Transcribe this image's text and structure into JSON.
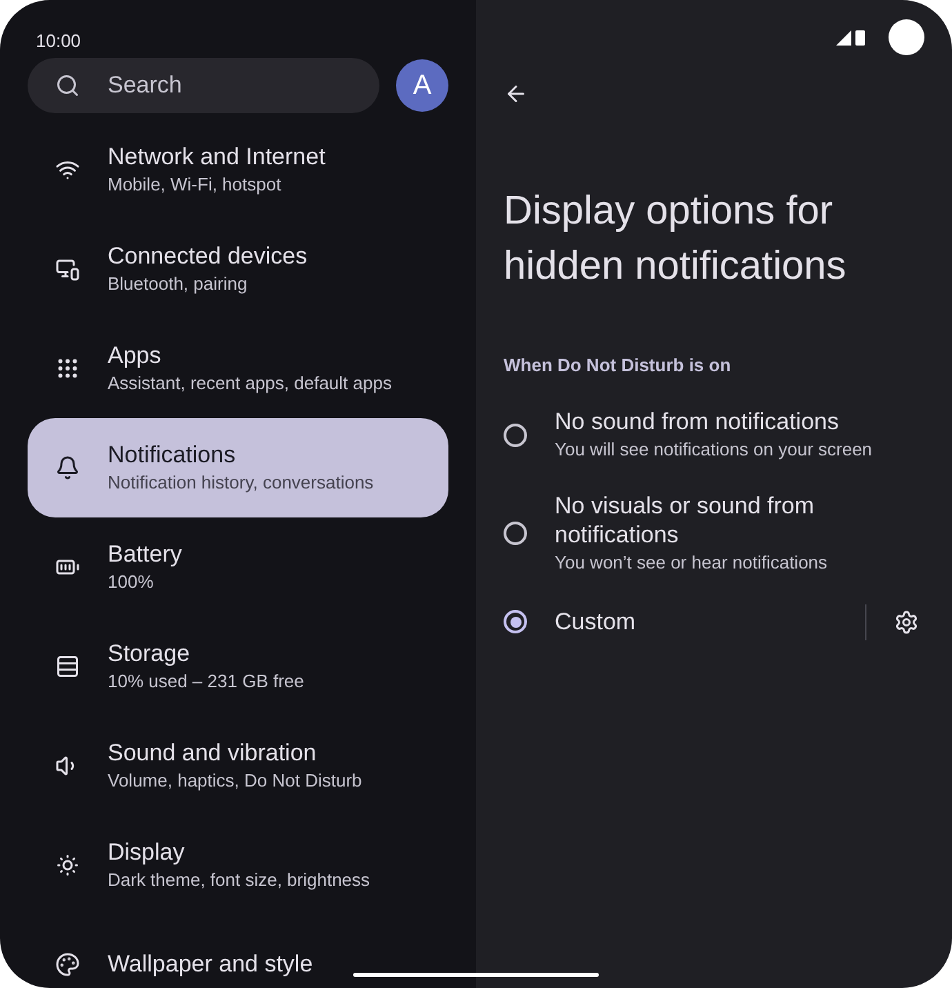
{
  "status_bar": {
    "time": "10:00"
  },
  "search": {
    "placeholder": "Search"
  },
  "avatar": {
    "initial": "A"
  },
  "sidebar": {
    "items": [
      {
        "kind": "wifi",
        "title": "Network and Internet",
        "subtitle": "Mobile, Wi-Fi, hotspot",
        "selected": false
      },
      {
        "kind": "devices",
        "title": "Connected devices",
        "subtitle": "Bluetooth, pairing",
        "selected": false
      },
      {
        "kind": "apps",
        "title": "Apps",
        "subtitle": "Assistant, recent apps, default apps",
        "selected": false
      },
      {
        "kind": "bell",
        "title": "Notifications",
        "subtitle": "Notification history, conversations",
        "selected": true
      },
      {
        "kind": "battery",
        "title": "Battery",
        "subtitle": "100%",
        "selected": false
      },
      {
        "kind": "storage",
        "title": "Storage",
        "subtitle": "10% used – 231 GB free",
        "selected": false
      },
      {
        "kind": "sound",
        "title": "Sound and vibration",
        "subtitle": "Volume, haptics, Do Not Disturb",
        "selected": false
      },
      {
        "kind": "display",
        "title": "Display",
        "subtitle": "Dark theme, font size, brightness",
        "selected": false
      },
      {
        "kind": "palette",
        "title": "Wallpaper and style",
        "selected": false
      }
    ]
  },
  "detail": {
    "title": "Display options for hidden notifications",
    "section": "When Do Not Disturb is on",
    "options": [
      {
        "label": "No sound from notifications",
        "description": "You will see notifications on your screen",
        "selected": false,
        "has_settings": false
      },
      {
        "label": "No visuals or sound from notifications",
        "description": "You won’t see or hear notifications",
        "selected": false,
        "has_settings": false
      },
      {
        "label": "Custom",
        "selected": true,
        "has_settings": true
      }
    ]
  }
}
